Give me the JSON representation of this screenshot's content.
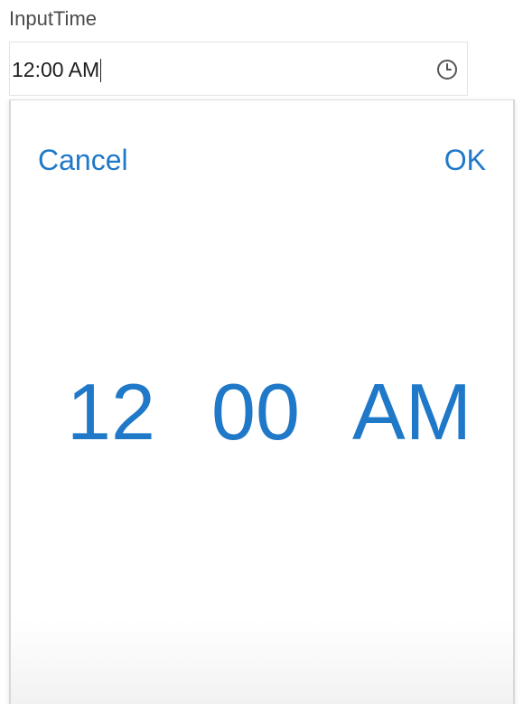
{
  "field": {
    "label": "InputTime",
    "value": "12:00 AM",
    "icon": "clock-icon"
  },
  "picker": {
    "cancel_label": "Cancel",
    "ok_label": "OK",
    "hour": "12",
    "minute": "00",
    "period": "AM"
  },
  "colors": {
    "accent": "#1f78c8",
    "text": "#1e1e1e",
    "label": "#4a4a4a"
  }
}
